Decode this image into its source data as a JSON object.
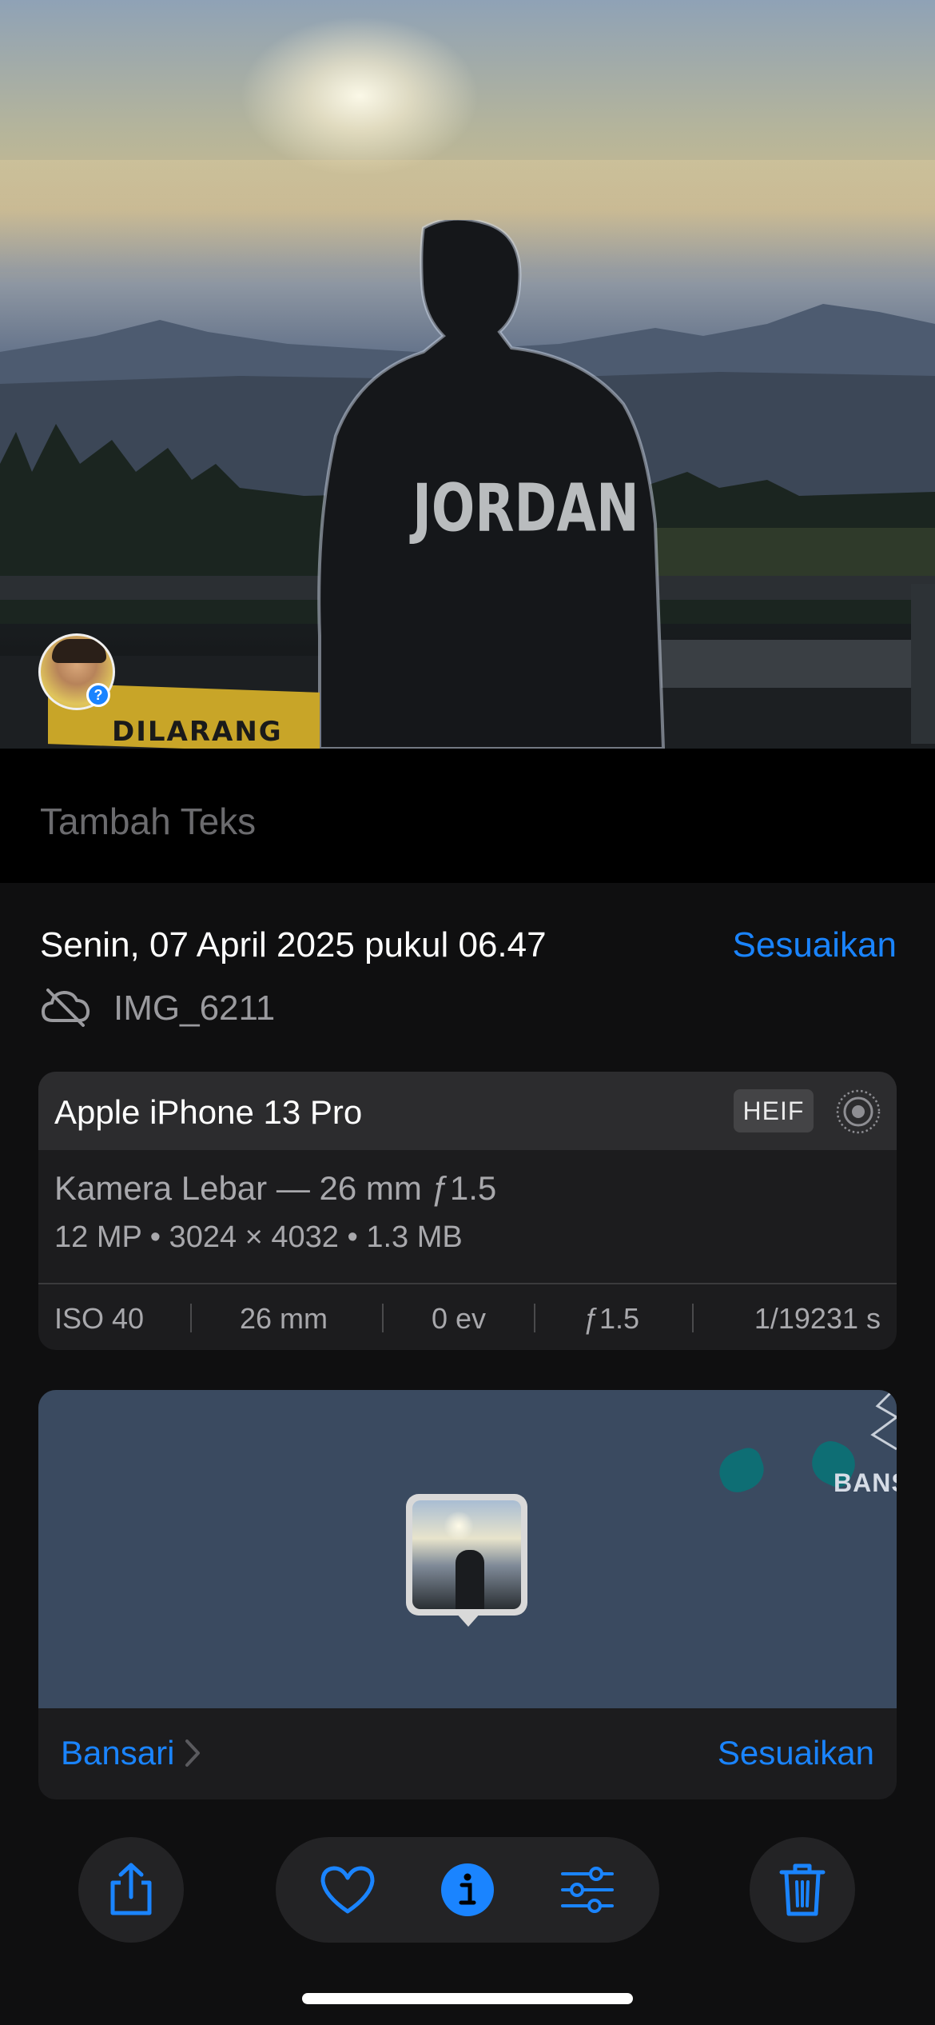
{
  "photo": {
    "sign_text": "DILARANG",
    "face_badge": "?"
  },
  "caption": {
    "placeholder": "Tambah Teks"
  },
  "info": {
    "date": "Senin, 07 April 2025 pukul 06.47",
    "adjust_label": "Sesuaikan",
    "filename": "IMG_6211"
  },
  "camera": {
    "device": "Apple iPhone 13 Pro",
    "format": "HEIF",
    "lens": "Kamera Lebar — 26 mm ƒ1.5",
    "specs": "12 MP • 3024 × 4032 • 1.3 MB",
    "exif": {
      "iso": "ISO 40",
      "focal": "26 mm",
      "ev": "0 ev",
      "aperture": "ƒ1.5",
      "shutter": "1/19231 s"
    }
  },
  "map": {
    "map_label": "BANS",
    "place": "Bansari",
    "adjust_label": "Sesuaikan"
  },
  "toolbar": {
    "icons": [
      "share-icon",
      "heart-icon",
      "info-icon",
      "sliders-icon",
      "trash-icon"
    ]
  },
  "colors": {
    "accent": "#1a84ff",
    "panel": "#0f0f10",
    "card": "#1c1c1e",
    "map": "#3a4a60"
  }
}
